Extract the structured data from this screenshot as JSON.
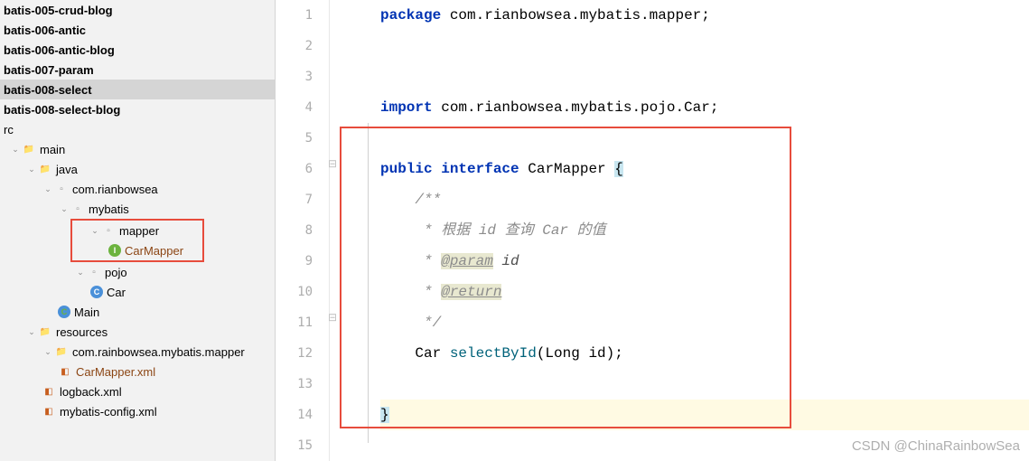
{
  "tree": {
    "items": [
      {
        "label": "batis-005-crud-blog",
        "bold": true
      },
      {
        "label": "batis-006-antic",
        "bold": true
      },
      {
        "label": "batis-006-antic-blog",
        "bold": true
      },
      {
        "label": "batis-007-param",
        "bold": true
      },
      {
        "label": "batis-008-select",
        "bold": true,
        "selected": true
      },
      {
        "label": "batis-008-select-blog",
        "bold": true
      }
    ],
    "src": "rc",
    "main": "main",
    "java": "java",
    "pkg1": "com.rianbowsea",
    "pkg2": "mybatis",
    "mapper_folder": "mapper",
    "carmapper": "CarMapper",
    "pojo_folder": "pojo",
    "car": "Car",
    "main_class": "Main",
    "resources": "resources",
    "pkg3": "com.rainbowsea.mybatis.mapper",
    "carmapper_xml": "CarMapper.xml",
    "logback_xml": "logback.xml",
    "mybatis_config": "mybatis-config.xml"
  },
  "code": {
    "line1": {
      "kw": "package",
      "rest": " com.rianbowsea.mybatis.mapper;"
    },
    "line4": {
      "kw": "import",
      "rest": " com.rianbowsea.mybatis.pojo.Car;"
    },
    "line6": {
      "kw1": "public",
      "kw2": "interface",
      "name": " CarMapper ",
      "brace": "{"
    },
    "line7": "    /**",
    "line8a": "     * ",
    "line8b": "根据 id 查询 Car 的值",
    "line9a": "     * ",
    "line9tag": "@param",
    "line9p": " id",
    "line10a": "     * ",
    "line10tag": "@return",
    "line11": "     */",
    "line12a": "    Car ",
    "line12m": "selectById",
    "line12b": "(Long id);",
    "line14": "}"
  },
  "gutter": [
    "1",
    "2",
    "3",
    "4",
    "5",
    "6",
    "7",
    "8",
    "9",
    "10",
    "11",
    "12",
    "13",
    "14",
    "15"
  ],
  "watermark": "CSDN @ChinaRainbowSea"
}
